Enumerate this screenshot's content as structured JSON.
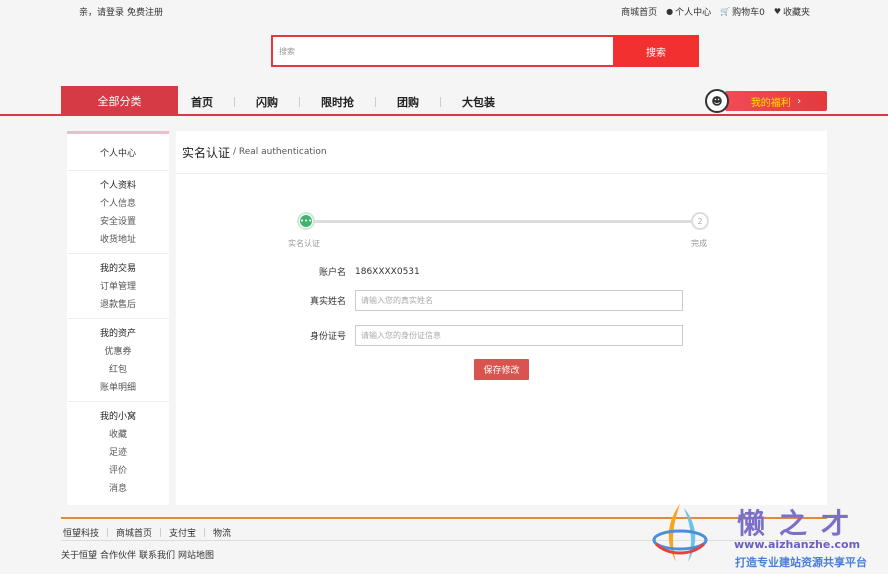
{
  "topbar": {
    "greeting": "亲，请登录",
    "register": "免费注册",
    "links": [
      {
        "label": "商城首页",
        "icon": ""
      },
      {
        "label": "个人中心",
        "icon": "user-icon"
      },
      {
        "label": "购物车0",
        "icon": "cart-icon"
      },
      {
        "label": "收藏夹",
        "icon": "heart-icon"
      }
    ]
  },
  "search": {
    "placeholder": "搜索",
    "button": "搜索"
  },
  "nav": {
    "all_categories": "全部分类",
    "links": [
      "首页",
      "闪购",
      "限时抢",
      "团购",
      "大包装"
    ],
    "welfare": "我的福利",
    "welfare_arrow": "›"
  },
  "sidebar": {
    "title": "个人中心",
    "groups": [
      {
        "head": "个人资料",
        "items": [
          "个人信息",
          "安全设置",
          "收货地址"
        ]
      },
      {
        "head": "我的交易",
        "items": [
          "订单管理",
          "退款售后"
        ]
      },
      {
        "head": "我的资产",
        "items": [
          "优惠券",
          "红包",
          "账单明细"
        ]
      },
      {
        "head": "我的小窝",
        "items": [
          "收藏",
          "足迹",
          "评价",
          "消息"
        ]
      }
    ]
  },
  "main": {
    "title_cn": "实名认证",
    "title_en": "/ Real authentication",
    "steps": {
      "step1_mark": "•••",
      "step1_label": "实名认证",
      "step2_mark": "2",
      "step2_label": "完成"
    },
    "form": {
      "account_label": "账户名",
      "account_value": "186XXXX0531",
      "name_label": "真实姓名",
      "name_placeholder": "请输入您的真实姓名",
      "id_label": "身份证号",
      "id_placeholder": "请输入您的身份证信息",
      "save": "保存修改"
    }
  },
  "footer": {
    "links": [
      "恒望科技",
      "商城首页",
      "支付宝",
      "物流"
    ],
    "bottom_links": [
      "关于恒望",
      "合作伙伴",
      "联系我们",
      "网站地图"
    ]
  },
  "watermark": {
    "brand": "懒之才",
    "url": "www.aizhanzhe.com",
    "slogan": "打造专业建站资源共享平台"
  },
  "colors": {
    "accent": "#e4393c",
    "nav_red": "#d63b45",
    "step_green": "#3fb46f",
    "save_red": "#d9534f"
  }
}
